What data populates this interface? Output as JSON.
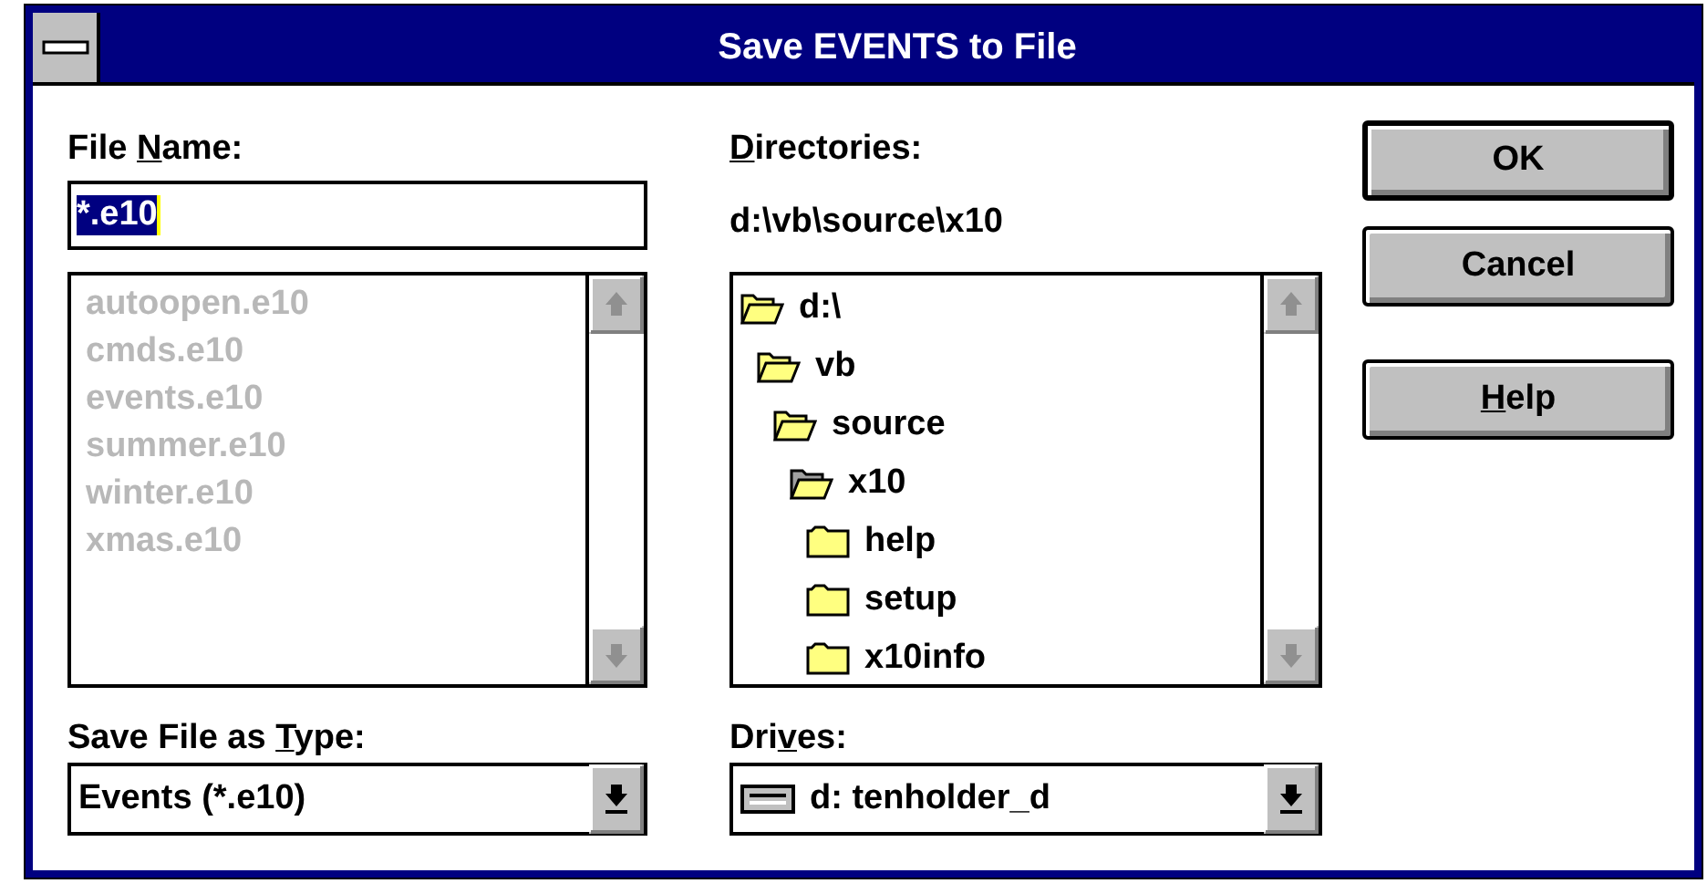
{
  "window": {
    "title": "Save EVENTS to File"
  },
  "file_name": {
    "label": {
      "before": "File ",
      "key": "N",
      "after": "ame:"
    },
    "value": "*.e10",
    "text_selected": true
  },
  "file_list": {
    "items": [
      {
        "name": "autoopen.e10",
        "disabled": true
      },
      {
        "name": "cmds.e10",
        "disabled": true
      },
      {
        "name": "events.e10",
        "disabled": true
      },
      {
        "name": "summer.e10",
        "disabled": true
      },
      {
        "name": "winter.e10",
        "disabled": true
      },
      {
        "name": "xmas.e10",
        "disabled": true
      }
    ]
  },
  "save_type": {
    "label": {
      "before": "Save File as ",
      "key": "T",
      "after": "ype:"
    },
    "value": "Events (*.e10)"
  },
  "directories": {
    "label": {
      "key": "D",
      "after": "irectories:"
    },
    "path": "d:\\vb\\source\\x10",
    "tree": [
      {
        "name": "d:\\",
        "kind": "open",
        "children": [
          {
            "name": "vb",
            "kind": "open",
            "children": [
              {
                "name": "source",
                "kind": "open",
                "children": [
                  {
                    "name": "x10",
                    "kind": "current",
                    "children": [
                      {
                        "name": "help",
                        "kind": "closed"
                      },
                      {
                        "name": "setup",
                        "kind": "closed"
                      },
                      {
                        "name": "x10info",
                        "kind": "closed"
                      }
                    ]
                  }
                ]
              }
            ]
          }
        ]
      }
    ]
  },
  "drives": {
    "label": {
      "before": "Dri",
      "key": "v",
      "after": "es:"
    },
    "value": "d: tenholder_d"
  },
  "buttons": [
    {
      "label": {
        "before": "OK"
      },
      "default": true
    },
    {
      "label": {
        "before": "Cancel"
      },
      "default": false
    },
    {
      "label": {
        "key": "H",
        "after": "elp"
      },
      "default": false
    }
  ]
}
